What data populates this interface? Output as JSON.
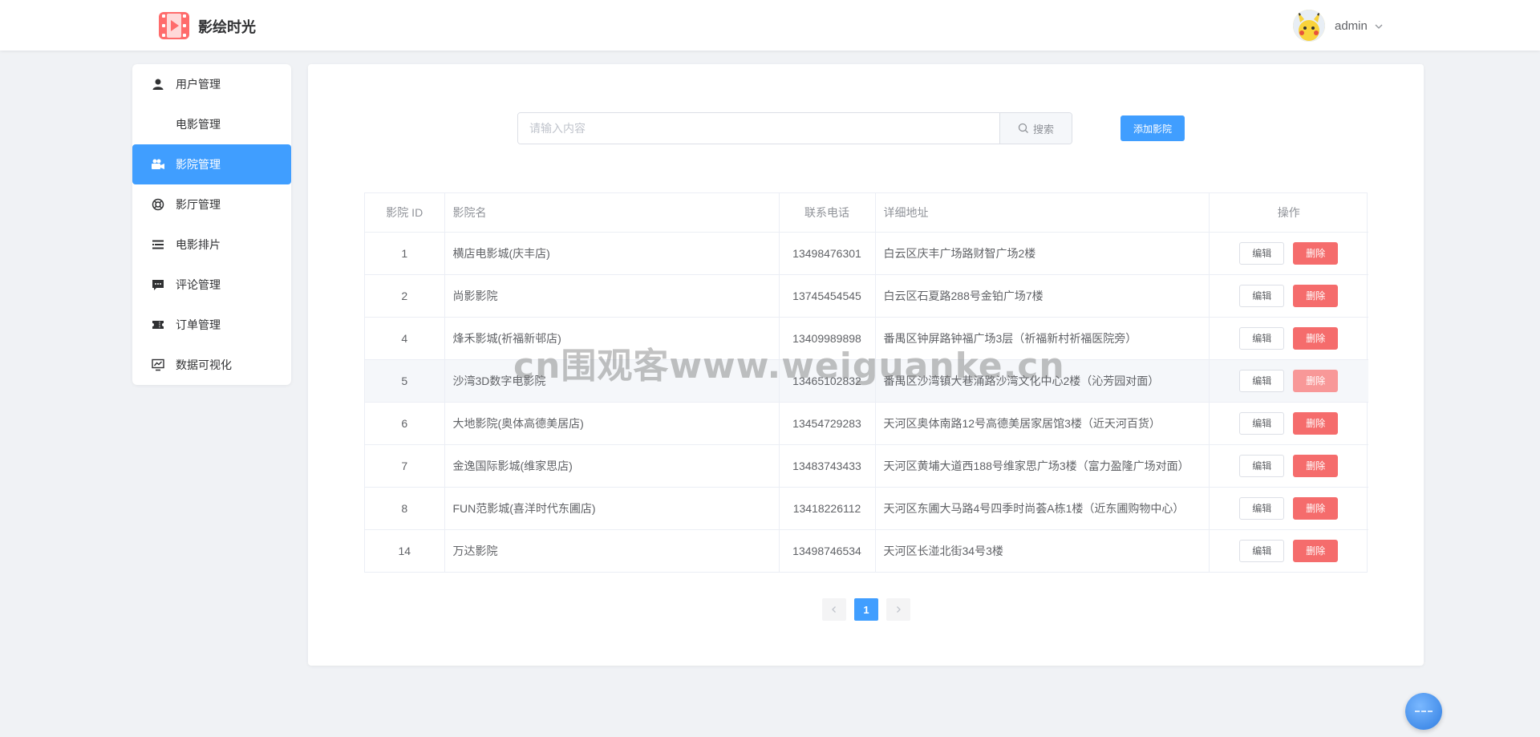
{
  "header": {
    "app_title": "影绘时光",
    "username": "admin"
  },
  "sidebar": {
    "items": [
      {
        "label": "用户管理",
        "icon": "user-icon",
        "active": false
      },
      {
        "label": "电影管理",
        "icon": "",
        "active": false
      },
      {
        "label": "影院管理",
        "icon": "camera-icon",
        "active": true
      },
      {
        "label": "影厅管理",
        "icon": "lifebuoy-icon",
        "active": false
      },
      {
        "label": "电影排片",
        "icon": "list-icon",
        "active": false
      },
      {
        "label": "评论管理",
        "icon": "comment-icon",
        "active": false
      },
      {
        "label": "订单管理",
        "icon": "ticket-icon",
        "active": false
      },
      {
        "label": "数据可视化",
        "icon": "chart-icon",
        "active": false
      }
    ]
  },
  "search": {
    "placeholder": "请输入内容",
    "button_label": "搜索"
  },
  "add_button_label": "添加影院",
  "table": {
    "headers": [
      "影院 ID",
      "影院名",
      "联系电话",
      "详细地址",
      "操作"
    ],
    "edit_label": "编辑",
    "delete_label": "删除",
    "rows": [
      {
        "id": "1",
        "name": "横店电影城(庆丰店)",
        "phone": "13498476301",
        "address": "白云区庆丰广场路财智广场2楼"
      },
      {
        "id": "2",
        "name": "尚影影院",
        "phone": "13745454545",
        "address": "白云区石夏路288号金铂广场7楼"
      },
      {
        "id": "4",
        "name": "烽禾影城(祈福新邨店)",
        "phone": "13409989898",
        "address": "番禺区钟屏路钟福广场3层（祈福新村祈福医院旁）"
      },
      {
        "id": "5",
        "name": "沙湾3D数字电影院",
        "phone": "13465102832",
        "address": "番禺区沙湾镇大巷涌路沙湾文化中心2楼（沁芳园对面）"
      },
      {
        "id": "6",
        "name": "大地影院(奥体高德美居店)",
        "phone": "13454729283",
        "address": "天河区奥体南路12号高德美居家居馆3楼（近天河百货）"
      },
      {
        "id": "7",
        "name": "金逸国际影城(维家思店)",
        "phone": "13483743433",
        "address": "天河区黄埔大道西188号维家思广场3楼（富力盈隆广场对面）"
      },
      {
        "id": "8",
        "name": "FUN范影城(喜洋时代东圃店)",
        "phone": "13418226112",
        "address": "天河区东圃大马路4号四季时尚荟A栋1楼（近东圃购物中心）"
      },
      {
        "id": "14",
        "name": "万达影院",
        "phone": "13498746534",
        "address": "天河区长湴北街34号3楼"
      }
    ]
  },
  "pagination": {
    "current": "1"
  },
  "watermark": "cn围观客www.weiguanke.cn",
  "colors": {
    "primary": "#409eff",
    "danger": "#f56c6c",
    "background": "#f0f2f5"
  }
}
